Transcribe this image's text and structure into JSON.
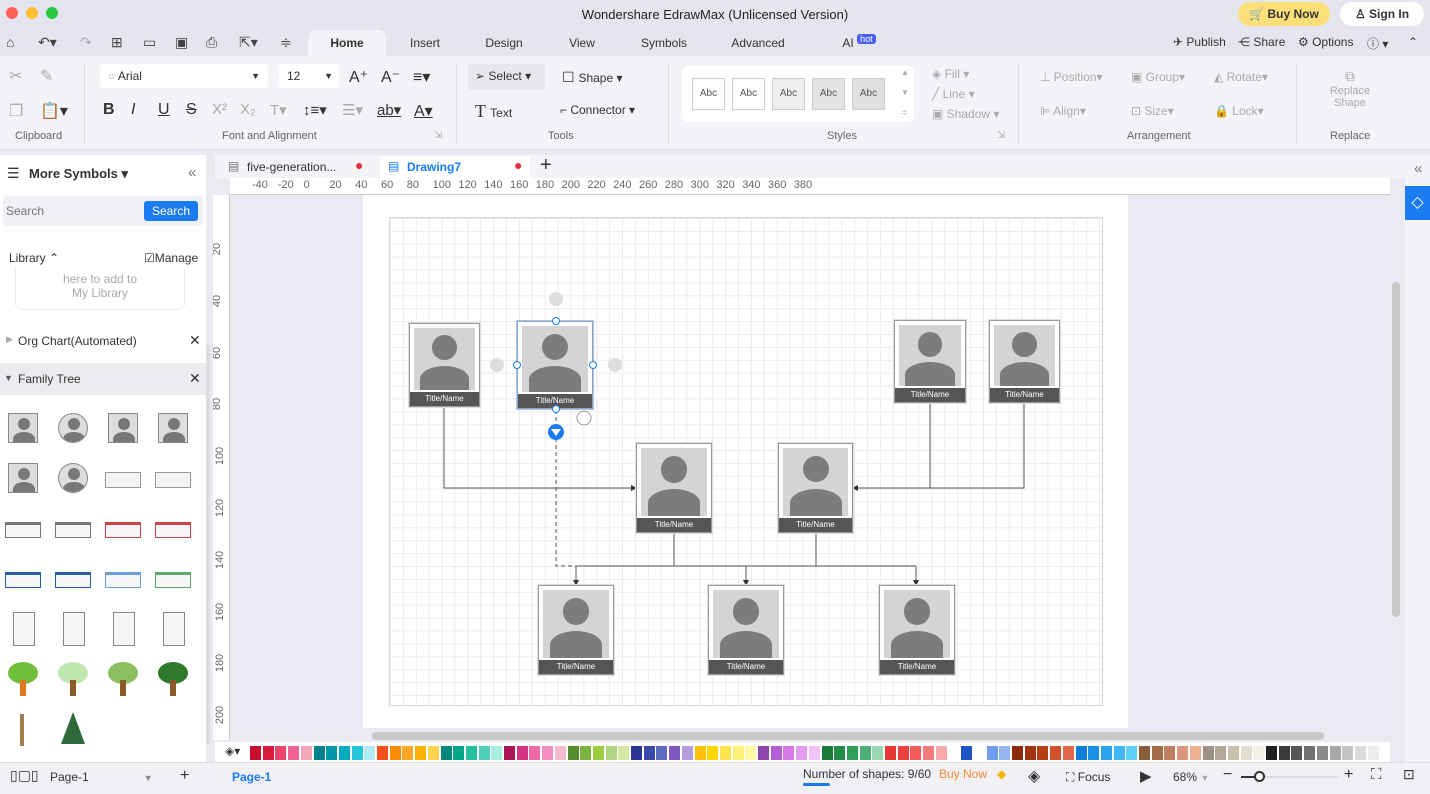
{
  "window": {
    "title": "Wondershare EdrawMax (Unlicensed Version)",
    "buy_now": "Buy Now",
    "sign_in": "Sign In"
  },
  "menu_tabs": [
    "Home",
    "Insert",
    "Design",
    "View",
    "Symbols",
    "Advanced",
    "AI"
  ],
  "ai_badge": "hot",
  "top_right": {
    "publish": "Publish",
    "share": "Share",
    "options": "Options"
  },
  "ribbon": {
    "font": "Arial",
    "font_size": "12",
    "select": "Select",
    "shape": "Shape",
    "text": "Text",
    "connector": "Connector",
    "style_swatch": "Abc",
    "fill": "Fill",
    "line": "Line",
    "shadow": "Shadow",
    "position": "Position",
    "group": "Group",
    "rotate": "Rotate",
    "align": "Align",
    "size": "Size",
    "lock": "Lock",
    "replace_shape": "Replace Shape",
    "groups": {
      "clipboard": "Clipboard",
      "font": "Font and Alignment",
      "tools": "Tools",
      "styles": "Styles",
      "arrangement": "Arrangement",
      "replace": "Replace"
    }
  },
  "sidebar": {
    "title": "More Symbols",
    "search_placeholder": "Search",
    "search_button": "Search",
    "library": "Library",
    "manage": "Manage",
    "library_hint_1": "here to add to",
    "library_hint_2": "My Library",
    "categories": [
      "Org Chart(Automated)",
      "Family Tree"
    ]
  },
  "doc_tabs": [
    {
      "name": "five-generation...",
      "unsaved": true
    },
    {
      "name": "Drawing7",
      "unsaved": true,
      "active": true
    }
  ],
  "ruler": {
    "h": [
      "-40",
      "-20",
      "0",
      "20",
      "40",
      "60",
      "80",
      "100",
      "120",
      "140",
      "160",
      "180",
      "200",
      "220",
      "240",
      "260",
      "280",
      "300",
      "320",
      "340",
      "360",
      "380"
    ],
    "v": [
      "20",
      "40",
      "60",
      "80",
      "100",
      "120",
      "140",
      "160",
      "180",
      "200"
    ]
  },
  "nodes": [
    "Title/Name",
    "Title/Name",
    "Title/Name",
    "Title/Name",
    "Title/Name",
    "Title/Name",
    "Title/Name",
    "Title/Name",
    "Title/Name"
  ],
  "palette": [
    "#c8102e",
    "#d81b3c",
    "#e8436a",
    "#f06292",
    "#f4a6b8",
    "#00838f",
    "#0097a7",
    "#00acc1",
    "#26c6da",
    "#b2ebf2",
    "#f4511e",
    "#fb8c00",
    "#ffa726",
    "#ffb300",
    "#ffd54f",
    "#00897b",
    "#00a88a",
    "#26bfa0",
    "#4dd0b8",
    "#a7ede0",
    "#ad1457",
    "#d63384",
    "#f06aa8",
    "#f48fc0",
    "#f8bbd0",
    "#558b2f",
    "#7cb342",
    "#9ccc3f",
    "#aed581",
    "#d4e8a3",
    "#283593",
    "#3949ab",
    "#5c6bc0",
    "#7e57c2",
    "#b39ddb",
    "#ffc107",
    "#ffd600",
    "#ffe34d",
    "#fff176",
    "#fff9a8",
    "#8e44ad",
    "#b55fd6",
    "#d678e6",
    "#e39bef",
    "#f0c4f7",
    "#1b7a3a",
    "#228b47",
    "#2e9e58",
    "#4caf78",
    "#9ad7b2",
    "#e53935",
    "#ef3f3f",
    "#f25c5c",
    "#f47b7b",
    "#f8a8a8",
    "#ffffff",
    "#1e56c8",
    "#ffffff",
    "#6f9ef0",
    "#93b6f2",
    "#8b2b0a",
    "#a0320d",
    "#b83e13",
    "#d0502a",
    "#e3674a",
    "#0b7fd6",
    "#1890e6",
    "#29a3ee",
    "#40b8f5",
    "#5fd0f8",
    "#8a5a3c",
    "#a56b48",
    "#c08060",
    "#d9967a",
    "#f0b090",
    "#9e9286",
    "#b5a898",
    "#cbbfae",
    "#e3dccf",
    "#f5f0e6",
    "#202020",
    "#3a3a3a",
    "#555555",
    "#707070",
    "#8a8a8a",
    "#a8a8a8",
    "#c4c4c4",
    "#dcdcdc",
    "#ececec"
  ],
  "status": {
    "page_select": "Page-1",
    "page_tab": "Page-1",
    "shapes": "Number of shapes: 9/60",
    "buy_now": "Buy Now",
    "focus": "Focus",
    "zoom": "68%",
    "zoom_percent": 68
  },
  "colors": {
    "accent": "#1a7cf0",
    "buy": "#fbe07a"
  }
}
